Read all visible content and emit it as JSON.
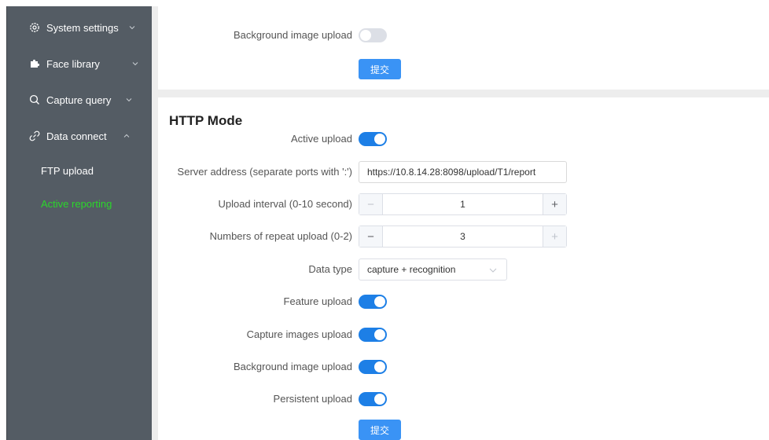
{
  "sidebar": {
    "items": [
      {
        "label": "System settings",
        "icon": "gear-icon",
        "expanded": false
      },
      {
        "label": "Face library",
        "icon": "puzzle-icon",
        "expanded": false
      },
      {
        "label": "Capture query",
        "icon": "search-icon",
        "expanded": false
      },
      {
        "label": "Data connect",
        "icon": "link-icon",
        "expanded": true
      }
    ],
    "sub_items": [
      {
        "label": "FTP upload",
        "active": false
      },
      {
        "label": "Active reporting",
        "active": true
      }
    ]
  },
  "top_panel": {
    "background_upload_label": "Background image upload",
    "background_upload_on": false,
    "submit_label": "提交"
  },
  "http": {
    "title": "HTTP Mode",
    "active_upload_label": "Active upload",
    "active_upload_on": true,
    "server_label": "Server address (separate ports with ':')",
    "server_value": "https://10.8.14.28:8098/upload/T1/report",
    "interval_label": "Upload interval (0-10 second)",
    "interval_value": "1",
    "repeat_label": "Numbers of repeat upload (0-2)",
    "repeat_value": "3",
    "data_type_label": "Data type",
    "data_type_value": "capture + recognition",
    "feature_label": "Feature upload",
    "feature_on": true,
    "capture_label": "Capture images upload",
    "capture_on": true,
    "background_label": "Background image upload",
    "background_on": true,
    "persistent_label": "Persistent upload",
    "persistent_on": true,
    "submit_label": "提交",
    "minus_symbol": "−",
    "plus_symbol": "+"
  },
  "colors": {
    "sidebar_bg": "#545c64",
    "active_text": "#2bd62b",
    "switch_on": "#1d7fe6",
    "switch_off": "#dcdfe6",
    "button": "#3a93f5"
  }
}
